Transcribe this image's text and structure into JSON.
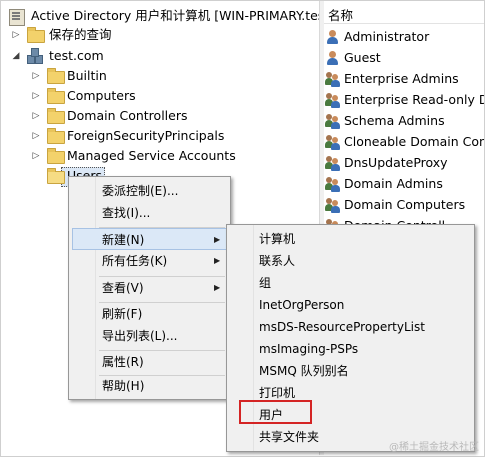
{
  "tree": {
    "root": "Active Directory 用户和计算机 [WIN-PRIMARY.test.",
    "saved_queries": "保存的查询",
    "domain": "test.com",
    "children": [
      "Builtin",
      "Computers",
      "Domain Controllers",
      "ForeignSecurityPrincipals",
      "Managed Service Accounts",
      "Users"
    ]
  },
  "list": {
    "column_name": "名称",
    "items": [
      {
        "name": "Administrator",
        "icon": "user-icon"
      },
      {
        "name": "Guest",
        "icon": "user-icon"
      },
      {
        "name": "Enterprise Admins",
        "icon": "group-icon"
      },
      {
        "name": "Enterprise Read-only D",
        "icon": "group-icon"
      },
      {
        "name": "Schema Admins",
        "icon": "group-icon"
      },
      {
        "name": "Cloneable Domain Cont",
        "icon": "group-icon"
      },
      {
        "name": "DnsUpdateProxy",
        "icon": "group-icon"
      },
      {
        "name": "Domain Admins",
        "icon": "group-icon"
      },
      {
        "name": "Domain Computers",
        "icon": "group-icon"
      },
      {
        "name": "Domain Controll",
        "icon": "group-icon"
      }
    ]
  },
  "context_menu": {
    "items": [
      "委派控制(E)...",
      "查找(I)...",
      "新建(N)",
      "所有任务(K)",
      "查看(V)",
      "刷新(F)",
      "导出列表(L)...",
      "属性(R)",
      "帮助(H)"
    ]
  },
  "new_submenu": {
    "items": [
      "计算机",
      "联系人",
      "组",
      "InetOrgPerson",
      "msDS-ResourcePropertyList",
      "msImaging-PSPs",
      "MSMQ 队列别名",
      "打印机",
      "用户",
      "共享文件夹"
    ]
  },
  "colors": {
    "highlight_box": "#d42424",
    "menu_hover": "#dbe8f7",
    "folder": "#f3d26b"
  },
  "watermark": "@稀土掘金技术社区"
}
